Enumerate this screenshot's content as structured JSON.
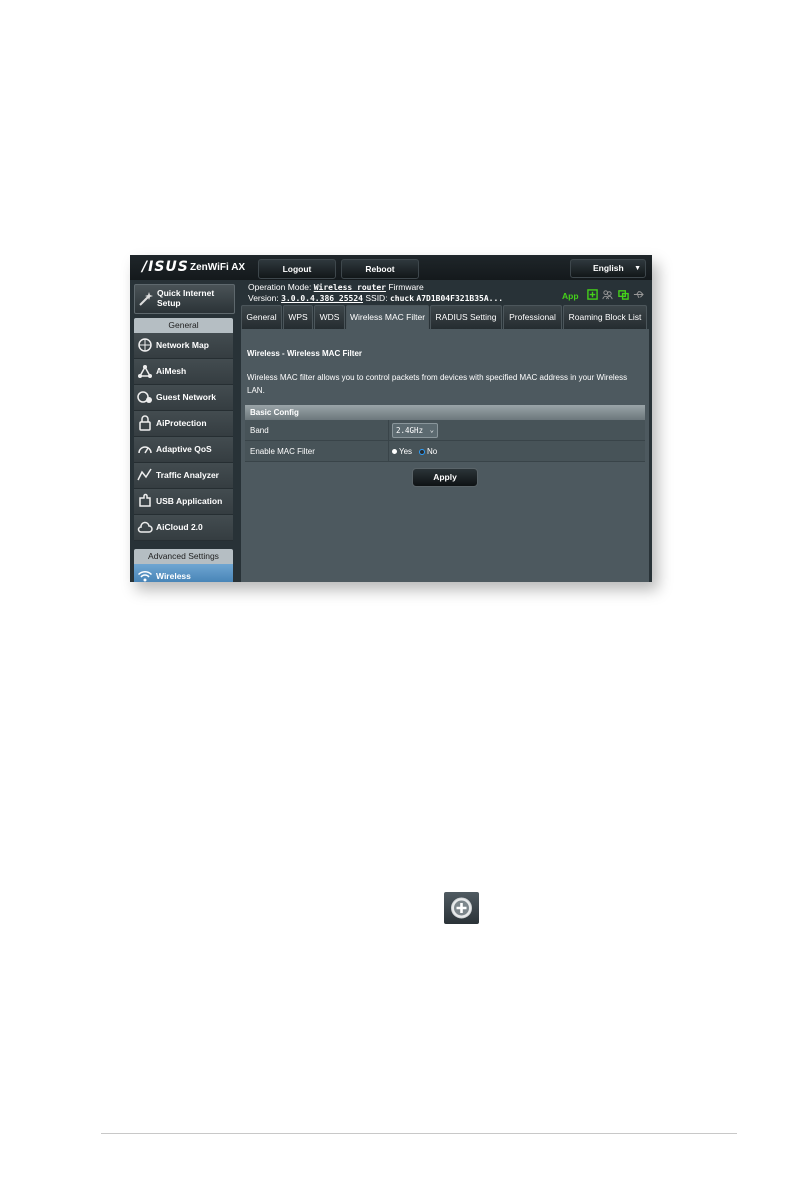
{
  "brand": {
    "logo": "/ISUS",
    "product": "ZenWiFi AX"
  },
  "topbar": {
    "logout": "Logout",
    "reboot": "Reboot",
    "language": "English"
  },
  "sidebar": {
    "quick_setup": "Quick Internet Setup",
    "general_header": "General",
    "items": [
      {
        "label": "Network Map",
        "icon": "network-map-icon"
      },
      {
        "label": "AiMesh",
        "icon": "aimesh-icon"
      },
      {
        "label": "Guest Network",
        "icon": "guest-network-icon"
      },
      {
        "label": "AiProtection",
        "icon": "lock-icon"
      },
      {
        "label": "Adaptive QoS",
        "icon": "gauge-icon"
      },
      {
        "label": "Traffic Analyzer",
        "icon": "traffic-icon"
      },
      {
        "label": "USB Application",
        "icon": "puzzle-icon"
      },
      {
        "label": "AiCloud 2.0",
        "icon": "cloud-icon"
      }
    ],
    "advanced_header": "Advanced Settings",
    "advanced_items": [
      {
        "label": "Wireless",
        "icon": "wifi-icon"
      }
    ]
  },
  "status": {
    "op_mode_label": "Operation Mode:",
    "op_mode_value": "Wireless router",
    "firmware_label": "Firmware",
    "version_label": "Version:",
    "version_value": "3.0.0.4.386_25524",
    "ssid_label": "SSID:",
    "ssid_value": "chuck",
    "ssid_extra": "A7D1B04F321B35A...",
    "app_label": "App"
  },
  "tabs": [
    "General",
    "WPS",
    "WDS",
    "Wireless MAC Filter",
    "RADIUS Setting",
    "Professional",
    "Roaming Block List"
  ],
  "content": {
    "title": "Wireless - Wireless MAC Filter",
    "description": "Wireless MAC filter allows you to control packets from devices with specified MAC address in your Wireless LAN.",
    "section": "Basic Config",
    "band_label": "Band",
    "band_value": "2.4GHz",
    "enable_label": "Enable MAC Filter",
    "yes": "Yes",
    "no": "No",
    "enable_value": "No",
    "apply": "Apply"
  },
  "colors": {
    "accent_green": "#45d11a",
    "sidebar_active": "#3a78ad",
    "panel": "#4d595f"
  }
}
